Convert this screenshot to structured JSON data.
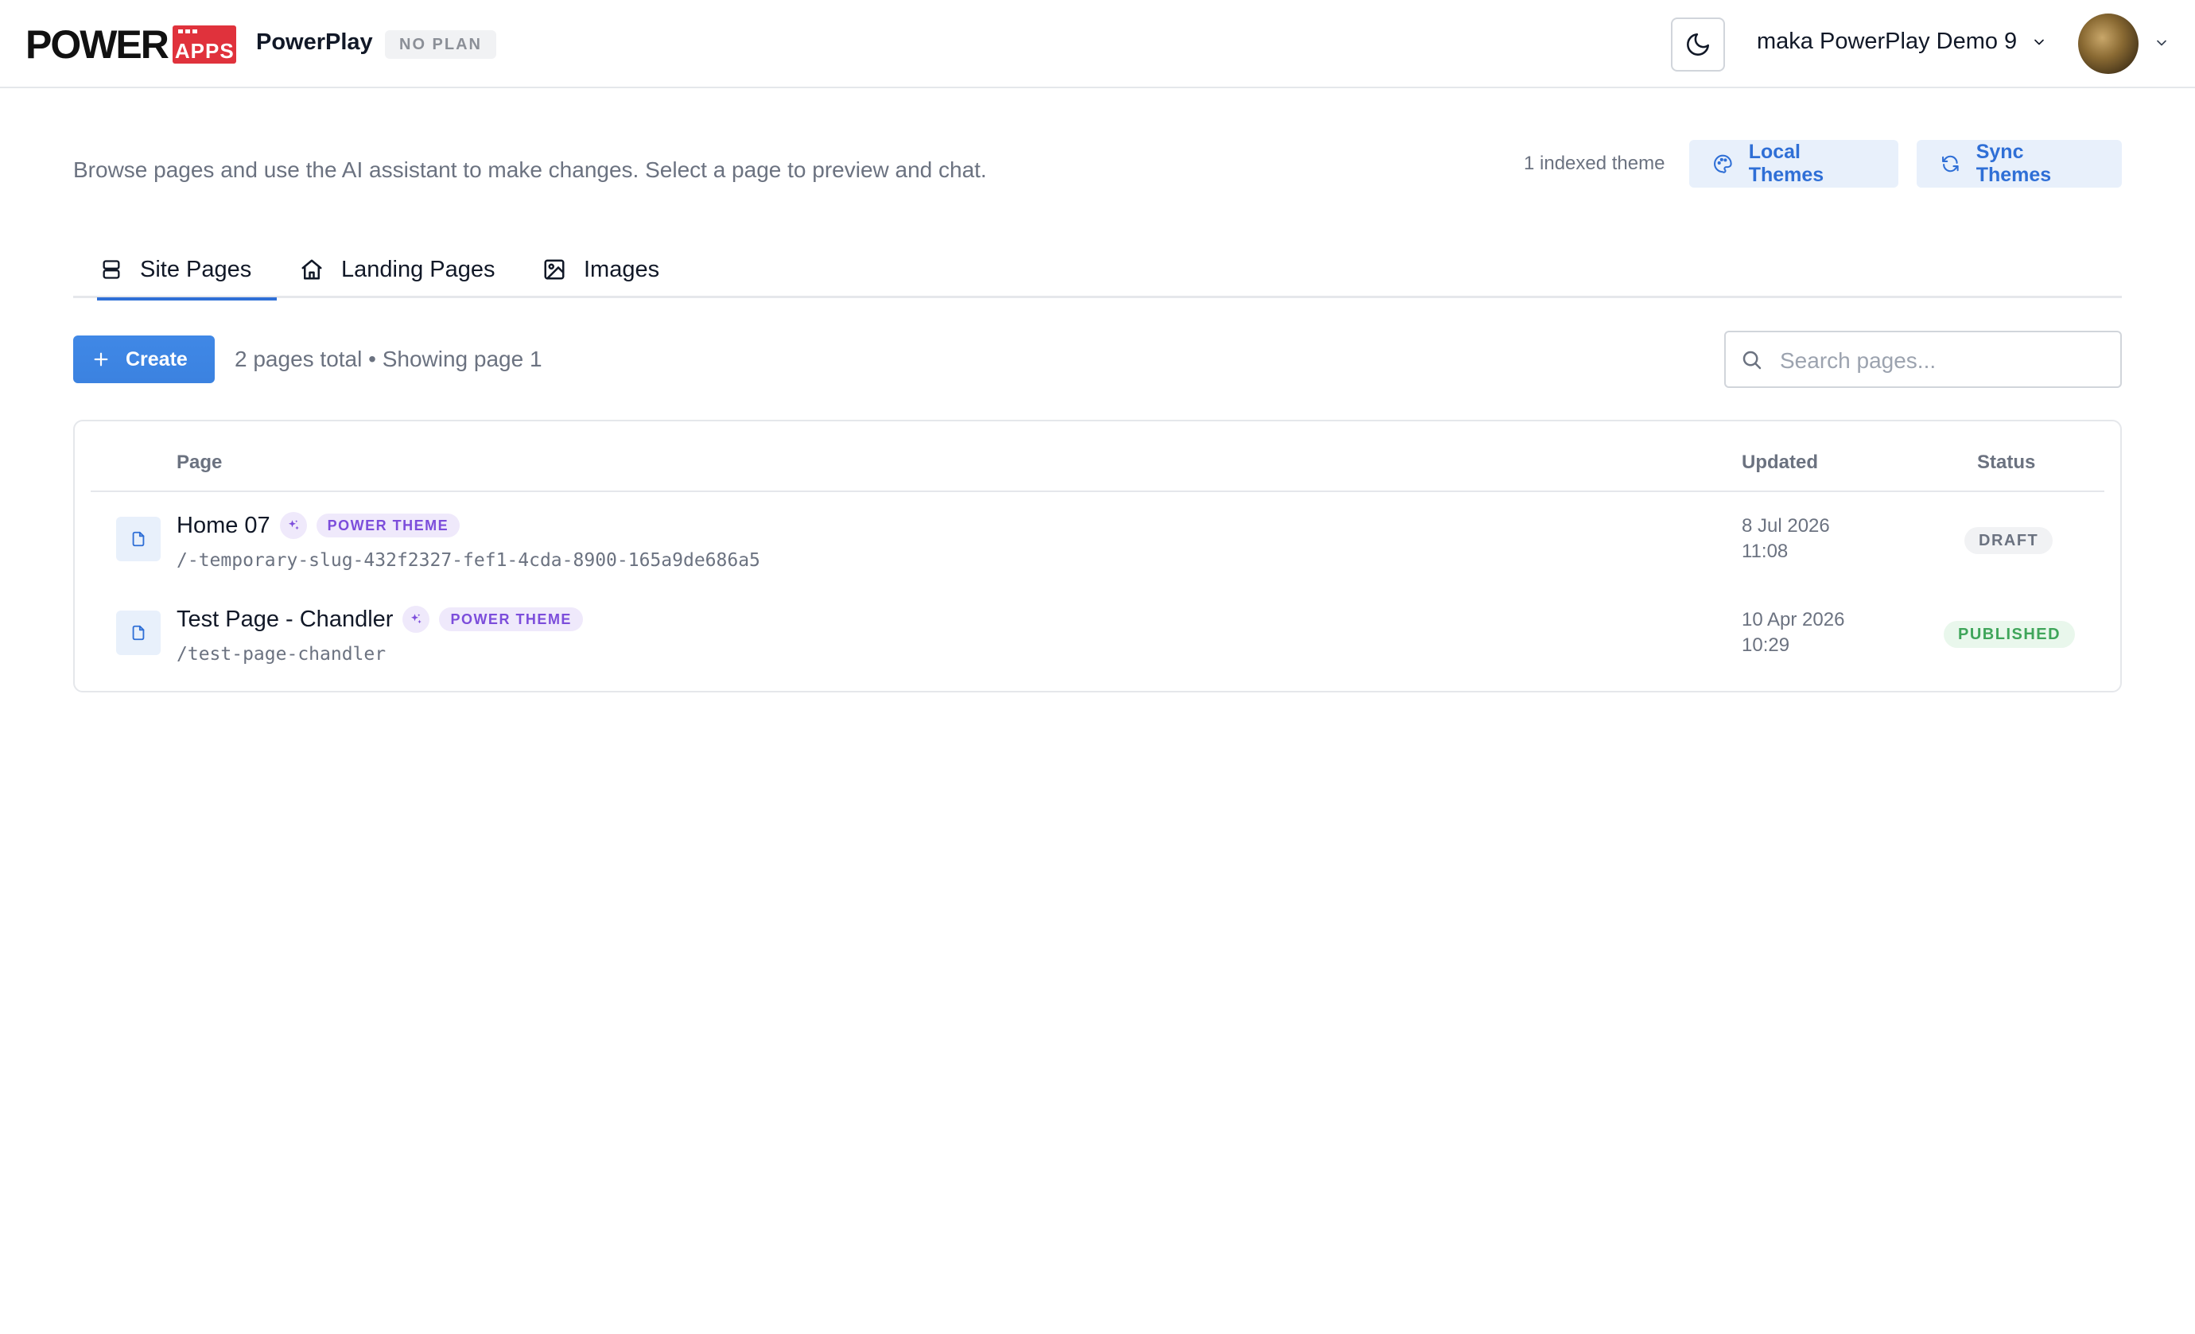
{
  "header": {
    "logo_word": "POWER",
    "logo_badge": "APPS",
    "app_name": "PowerPlay",
    "plan_badge": "NO PLAN",
    "workspace_name": "maka PowerPlay Demo 9"
  },
  "intro": {
    "description": "Browse pages and use the AI assistant to make changes. Select a page to preview and chat.",
    "indexed_themes": "1 indexed theme",
    "local_themes_label": "Local Themes",
    "sync_themes_label": "Sync Themes"
  },
  "tabs": [
    {
      "label": "Site Pages",
      "icon": "server-stack-icon",
      "active": true
    },
    {
      "label": "Landing Pages",
      "icon": "home-icon",
      "active": false
    },
    {
      "label": "Images",
      "icon": "image-icon",
      "active": false
    }
  ],
  "toolbar": {
    "create_label": "Create",
    "page_count": "2 pages total • Showing page 1",
    "search_placeholder": "Search pages...",
    "search_value": ""
  },
  "table": {
    "columns": {
      "page": "Page",
      "updated": "Updated",
      "status": "Status"
    },
    "rows": [
      {
        "title": "Home 07",
        "badge": "POWER THEME",
        "slug": "/-temporary-slug-432f2327-fef1-4cda-8900-165a9de686a5",
        "updated_date": "8 Jul 2026",
        "updated_time": "11:08",
        "status": "DRAFT"
      },
      {
        "title": "Test Page - Chandler",
        "badge": "POWER THEME",
        "slug": "/test-page-chandler",
        "updated_date": "10 Apr 2026",
        "updated_time": "10:29",
        "status": "PUBLISHED"
      }
    ]
  },
  "colors": {
    "accent": "#2f6fd6",
    "create_button": "#3b82e0",
    "brand_red": "#e0323c",
    "badge_purple": "#7c4ddb",
    "published_green": "#3fa55a"
  }
}
